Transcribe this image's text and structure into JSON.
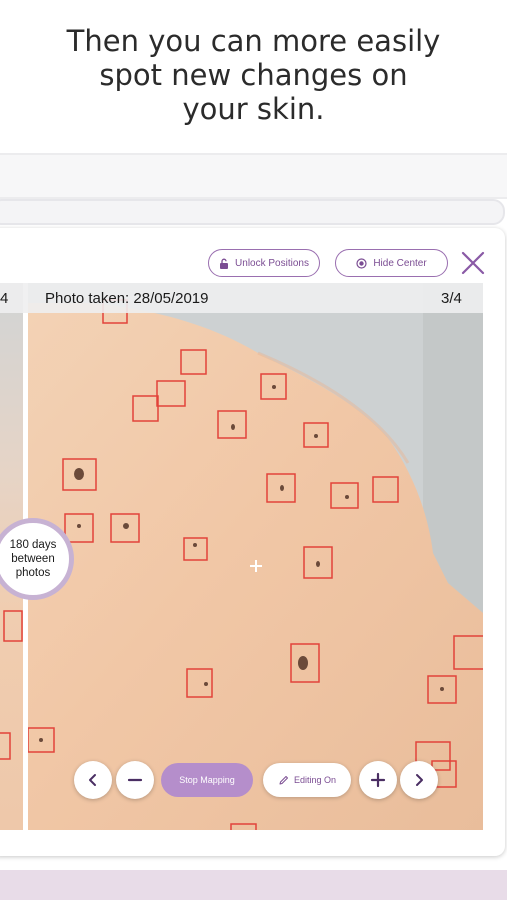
{
  "headline": {
    "line1": "Then you can more easily",
    "line2": "spot new changes on",
    "line3": "your skin."
  },
  "toolbar": {
    "unlock_label": "Unlock Positions",
    "hide_center_label": "Hide Center"
  },
  "left_photo": {
    "counter": "4"
  },
  "main_photo": {
    "taken_label": "Photo taken:",
    "date": "28/05/2019",
    "counter": "3/4"
  },
  "comparison": {
    "days_text": "180 days between photos"
  },
  "controls": {
    "stop_label": "Stop Mapping",
    "editing_label": "Editing On"
  },
  "colors": {
    "accent": "#b58ecb",
    "accent_dark": "#7b4d93",
    "marker": "#e2433a"
  }
}
